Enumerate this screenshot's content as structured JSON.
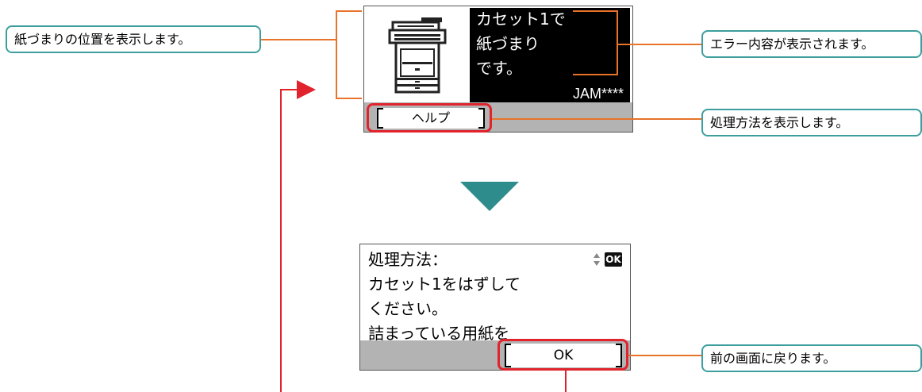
{
  "callouts": {
    "jam_position": "紙づまりの位置を表示します。",
    "error_content": "エラー内容が表示されます。",
    "procedure": "処理方法を表示します。",
    "back": "前の画面に戻ります。"
  },
  "screen1": {
    "message_lines": [
      "カセット1で",
      "紙づまり",
      "です。"
    ],
    "code": "JAM****",
    "help_key": "ヘルプ"
  },
  "screen2": {
    "title": "処理方法：",
    "lines": [
      "カセット1をはずして",
      "ください。",
      "詰まっている用紙を"
    ],
    "ok_key": "OK",
    "ok_icon": "OK"
  },
  "colors": {
    "callout_border": "#3e9e9e",
    "leader_orange": "#e8732a",
    "highlight_red": "#e0232c",
    "arrow_teal": "#2e8c8c",
    "softkey_bar": "#b3b3b3"
  }
}
